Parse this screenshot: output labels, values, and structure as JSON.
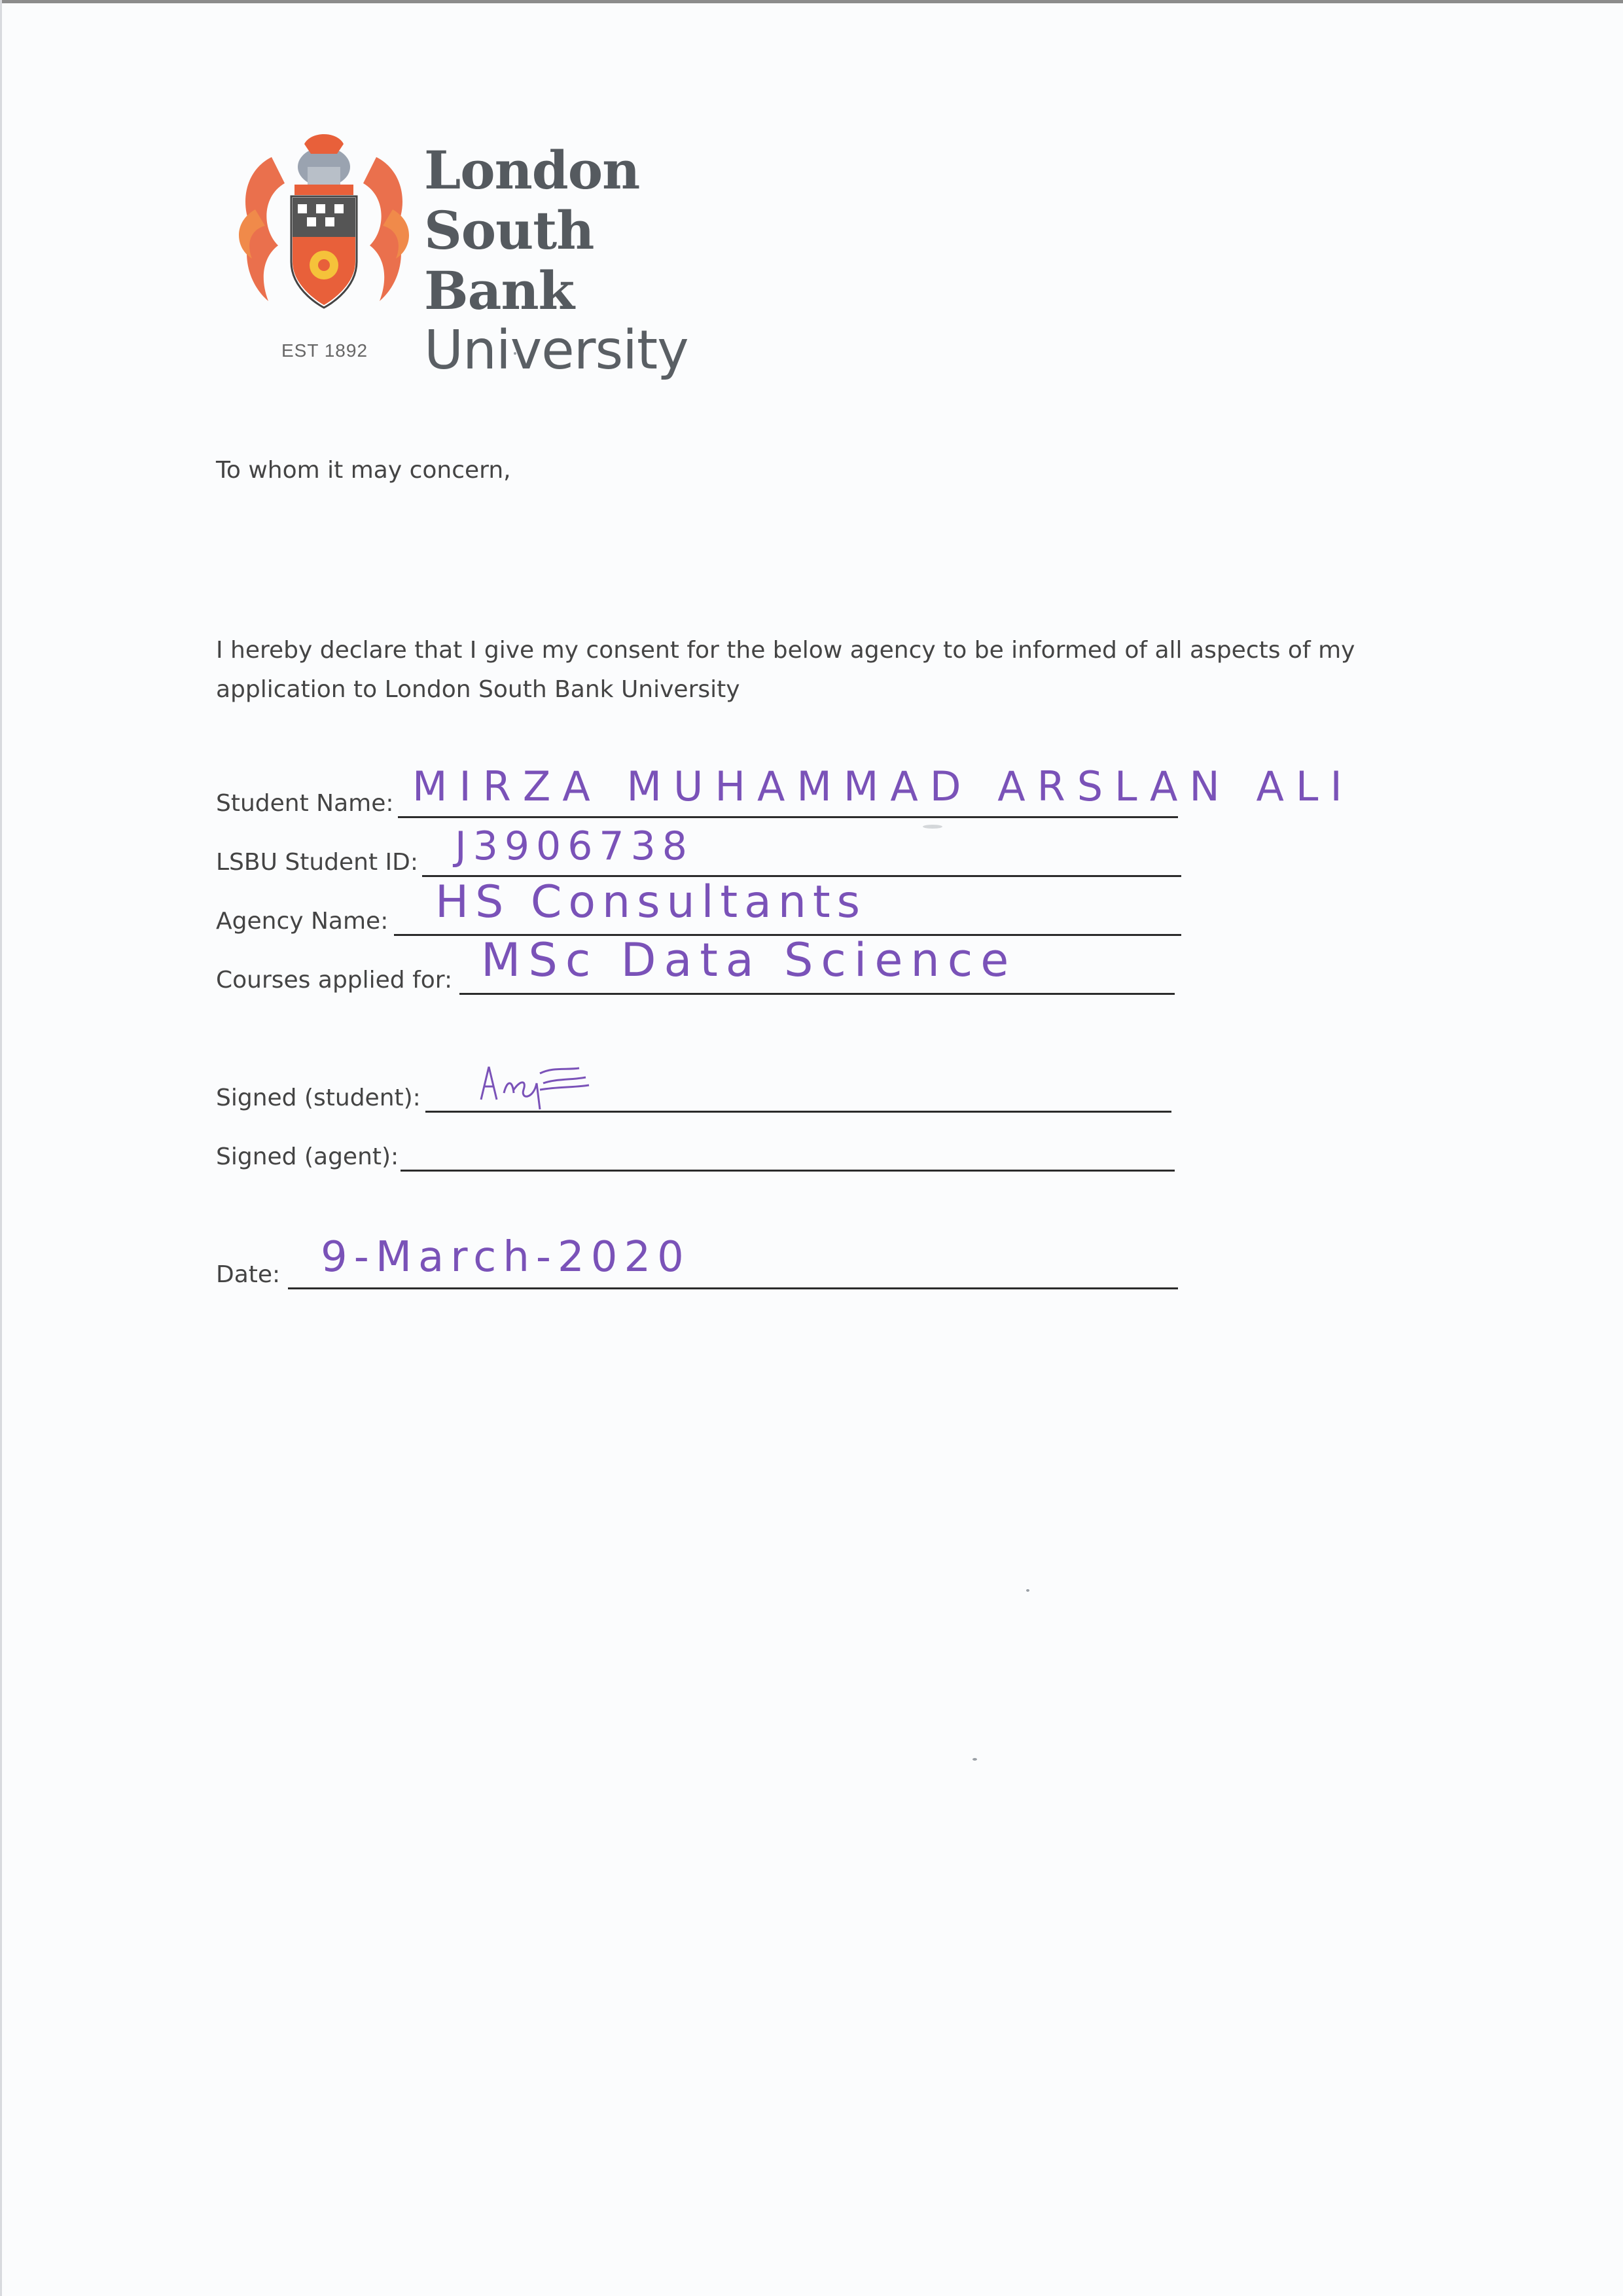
{
  "letterhead": {
    "line1": "London",
    "line2": "South Bank",
    "line3": "University",
    "est": "EST 1892"
  },
  "salutation": "To whom it may concern,",
  "declaration": "I hereby declare that I give my consent for the below agency to be informed of all aspects of my application to London South Bank University",
  "form": {
    "student_name": {
      "label": "Student Name:",
      "value": "MIRZA MUHAMMAD ARSLAN ALI"
    },
    "student_id": {
      "label": "LSBU Student ID:",
      "value": "J3906738"
    },
    "agency_name": {
      "label": "Agency Name:",
      "value": "HS Consultants"
    },
    "courses": {
      "label": "Courses applied for:",
      "value": "MSc Data Science"
    },
    "signed_student": {
      "label": "Signed (student):",
      "value": "Arslan"
    },
    "signed_agent": {
      "label": "Signed (agent):",
      "value": ""
    },
    "date": {
      "label": "Date:",
      "value": "9-March-2020"
    }
  },
  "colors": {
    "ink": "#7a52b8",
    "crest_orange": "#e8603a",
    "wordmark_grey": "#555a5f"
  }
}
